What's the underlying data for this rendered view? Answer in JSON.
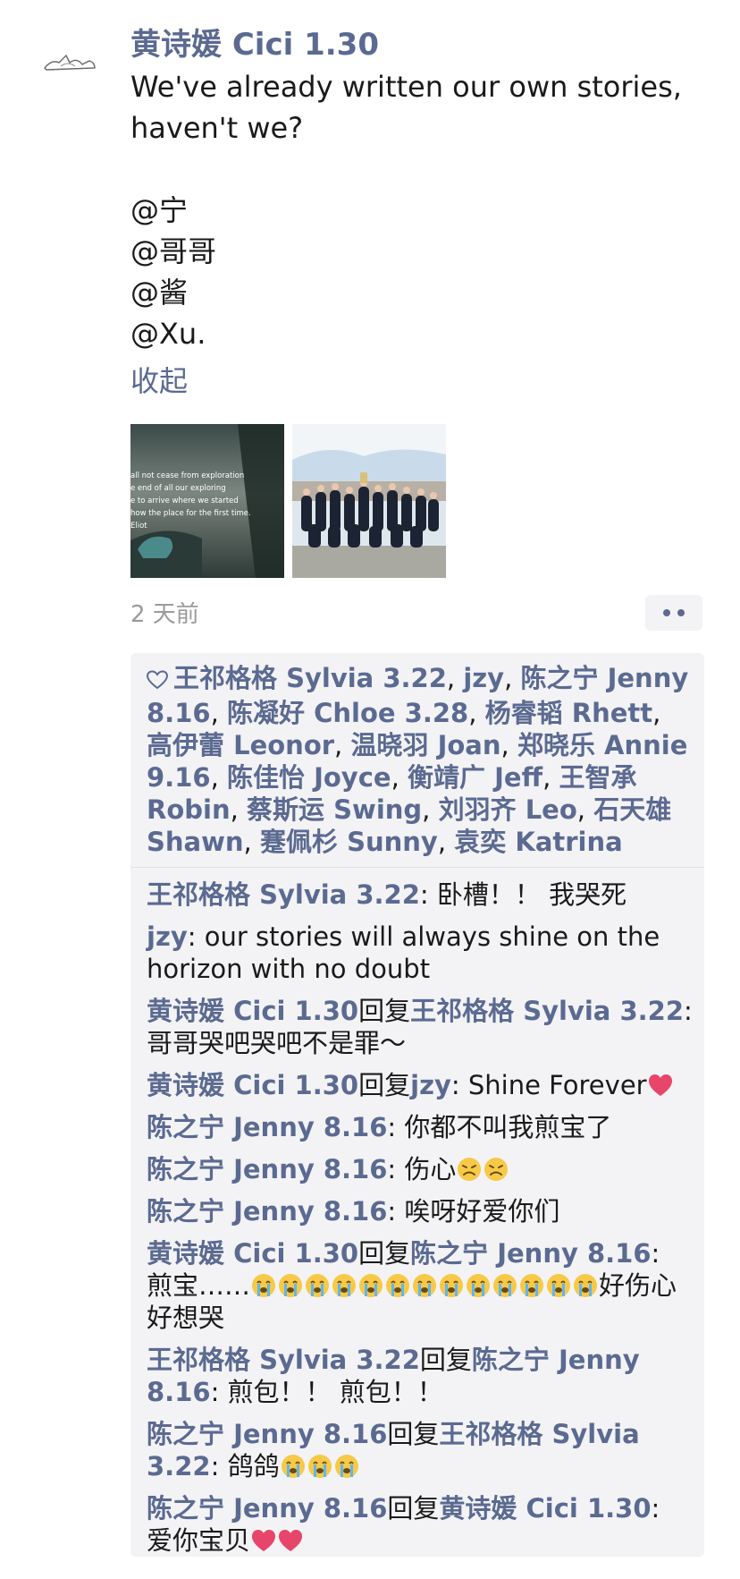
{
  "post": {
    "author": "黄诗媛 Cici 1.30",
    "text_line1": "We've already written our own stories,",
    "text_line2": "haven't we?",
    "mentions": [
      "@宁",
      "@哥哥",
      "@酱",
      "@Xu."
    ],
    "collapse_label": "收起",
    "photo1_lines": [
      "all not cease from exploration",
      "e end of all our exploring",
      "e to arrive where we started",
      "how the place for the first time.",
      "Eliot"
    ],
    "time": "2 天前"
  },
  "likes": {
    "names": [
      "王祁格格 Sylvia 3.22",
      "jzy",
      "陈之宁 Jenny 8.16",
      "陈凝好 Chloe 3.28",
      "杨睿韬 Rhett",
      "高伊蕾 Leonor",
      "温晓羽 Joan",
      "郑晓乐 Annie 9.16",
      "陈佳怡 Joyce",
      "衡靖广 Jeff",
      "王智承 Robin",
      "蔡斯运 Swing",
      "刘羽齐 Leo",
      "石天雄 Shawn",
      "蹇佩杉 Sunny",
      "袁奕 Katrina"
    ]
  },
  "reply_word": "回复",
  "comments": [
    {
      "from": "王祁格格 Sylvia 3.22",
      "to": "",
      "text": ": 卧槽！！ 我哭死",
      "emoji": [],
      "emoji_count": 0,
      "after": ""
    },
    {
      "from": "jzy",
      "to": "",
      "text": ": our stories will always shine on the horizon with no doubt",
      "emoji": [],
      "emoji_count": 0,
      "after": ""
    },
    {
      "from": "黄诗媛 Cici 1.30",
      "to": "王祁格格 Sylvia 3.22",
      "text": ": 哥哥哭吧哭吧不是罪～",
      "emoji": [],
      "emoji_count": 0,
      "after": ""
    },
    {
      "from": "黄诗媛 Cici 1.30",
      "to": "jzy",
      "text": ": Shine Forever",
      "emoji": [
        "heart"
      ],
      "emoji_count": 1,
      "after": ""
    },
    {
      "from": "陈之宁 Jenny 8.16",
      "to": "",
      "text": ": 你都不叫我煎宝了",
      "emoji": [],
      "emoji_count": 0,
      "after": ""
    },
    {
      "from": "陈之宁 Jenny 8.16",
      "to": "",
      "text": ": 伤心",
      "emoji": [
        "angry-face",
        "angry-face"
      ],
      "emoji_count": 2,
      "after": ""
    },
    {
      "from": "陈之宁 Jenny 8.16",
      "to": "",
      "text": ": 唉呀好爱你们",
      "emoji": [],
      "emoji_count": 0,
      "after": ""
    },
    {
      "from": "黄诗媛 Cici 1.30",
      "to": "陈之宁 Jenny 8.16",
      "text": ": 煎宝……",
      "emoji": [
        "crying-face",
        "crying-face",
        "crying-face",
        "crying-face",
        "crying-face",
        "crying-face",
        "crying-face",
        "crying-face",
        "crying-face",
        "crying-face",
        "crying-face",
        "crying-face",
        "crying-face"
      ],
      "emoji_count": 13,
      "after": "好伤心好想哭"
    },
    {
      "from": "王祁格格 Sylvia 3.22",
      "to": "陈之宁 Jenny 8.16",
      "text": ": 煎包！！ 煎包！！",
      "emoji": [],
      "emoji_count": 0,
      "after": ""
    },
    {
      "from": "陈之宁 Jenny 8.16",
      "to": "王祁格格 Sylvia 3.22",
      "text": ": 鸽鸽",
      "emoji": [
        "crying-face",
        "crying-face",
        "crying-face"
      ],
      "emoji_count": 3,
      "after": ""
    },
    {
      "from": "陈之宁 Jenny 8.16",
      "to": "黄诗媛 Cici 1.30",
      "text": ": 爱你宝贝",
      "emoji": [
        "heart",
        "heart"
      ],
      "emoji_count": 2,
      "after": ""
    }
  ],
  "colors": {
    "link": "#5b6a91",
    "panel": "#f3f3f5",
    "time": "#9a9a9a",
    "heart": "#e8456b"
  }
}
